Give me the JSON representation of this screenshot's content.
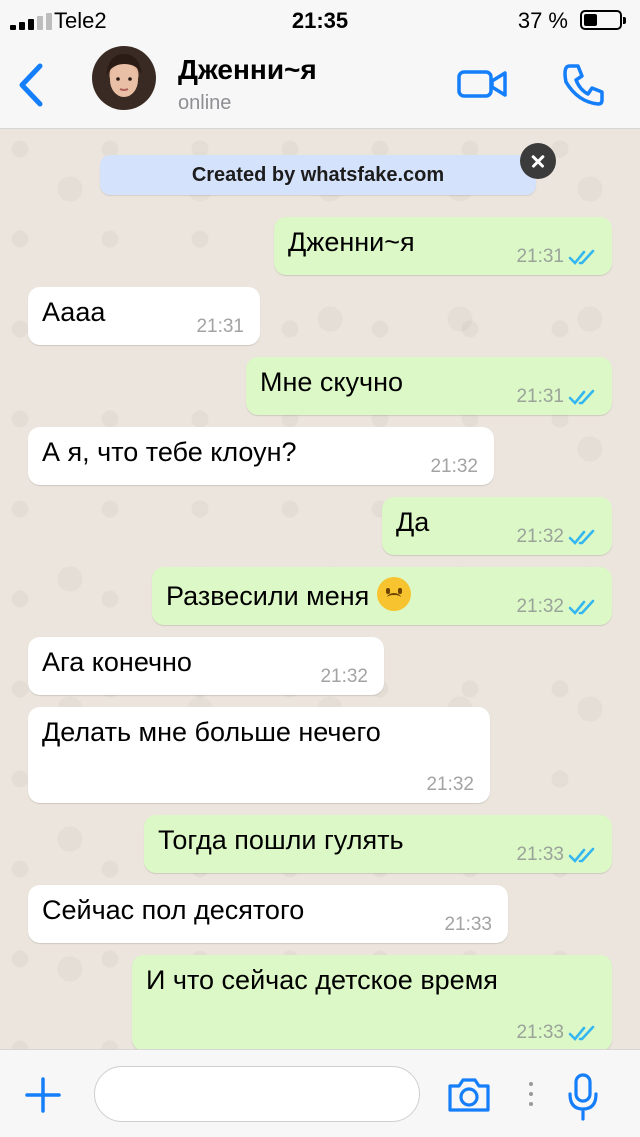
{
  "status_bar": {
    "carrier": "Tele2",
    "time": "21:35",
    "battery_percent": "37 %",
    "battery_level": 0.37,
    "signal_bars": 5,
    "signal_bars_active": 3
  },
  "header": {
    "contact_name": "Дженни~я",
    "contact_status": "online",
    "icons": [
      "back-chevron-icon",
      "avatar",
      "video-camera-icon",
      "phone-icon"
    ]
  },
  "banner": {
    "text": "Created by whatsfake.com"
  },
  "messages": [
    {
      "direction": "out",
      "text": "Дженни~я",
      "time": "21:31",
      "read": true
    },
    {
      "direction": "in",
      "text": "Аааа",
      "time": "21:31"
    },
    {
      "direction": "out",
      "text": "Мне скучно",
      "time": "21:31",
      "read": true
    },
    {
      "direction": "in",
      "text": "А я, что тебе клоун?",
      "time": "21:32"
    },
    {
      "direction": "out",
      "text": "Да",
      "time": "21:32",
      "read": true
    },
    {
      "direction": "out",
      "text": "Развесили меня",
      "emoji": "upside-down-face",
      "time": "21:32",
      "read": true
    },
    {
      "direction": "in",
      "text": "Ага конечно",
      "time": "21:32"
    },
    {
      "direction": "in",
      "text": "Делать мне больше нечего",
      "time": "21:32"
    },
    {
      "direction": "out",
      "text": "Тогда пошли гулять",
      "time": "21:33",
      "read": true
    },
    {
      "direction": "in",
      "text": "Сейчас пол десятого",
      "time": "21:33"
    },
    {
      "direction": "out",
      "text": "И что сейчас детское время",
      "time": "21:33",
      "read": true
    }
  ],
  "input_bar": {
    "value": "",
    "placeholder": "",
    "icons": [
      "plus-icon",
      "camera-icon",
      "more-dots-icon",
      "microphone-icon"
    ]
  },
  "colors": {
    "accent": "#147efb",
    "outgoing_bubble": "#dcf8c6",
    "incoming_bubble": "#ffffff",
    "chat_background": "#ece5dd",
    "read_ticks": "#34b7f1",
    "banner": "#d5e2fb"
  }
}
